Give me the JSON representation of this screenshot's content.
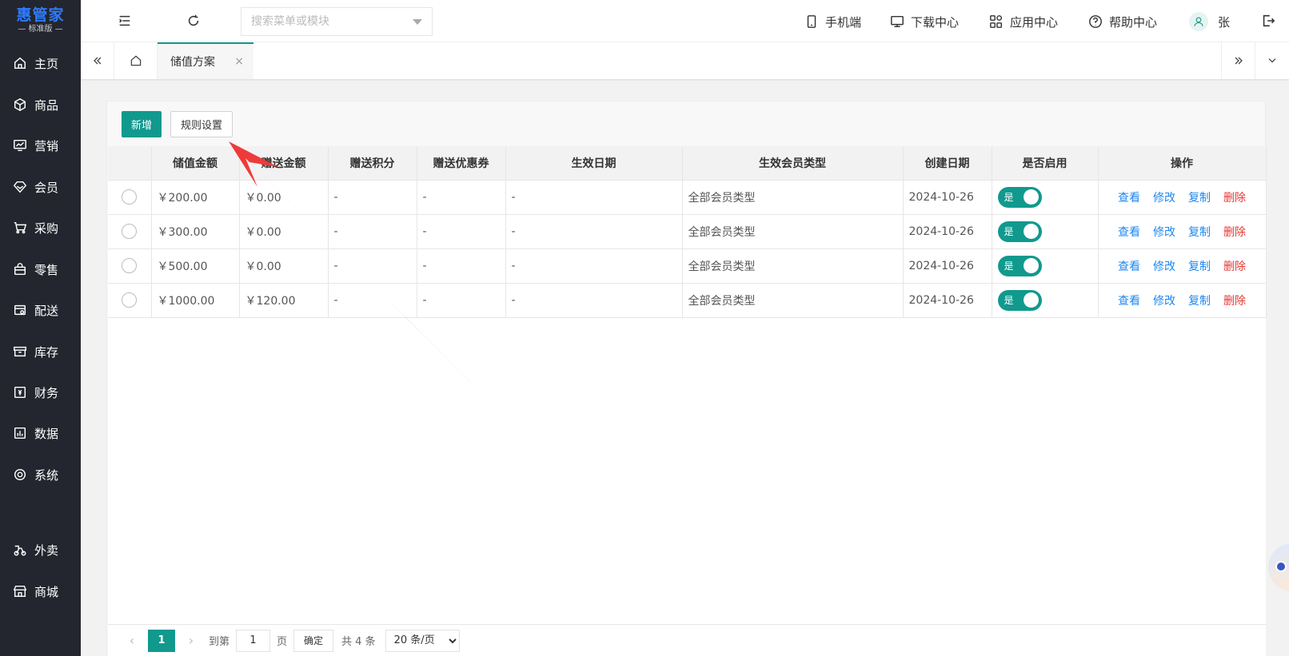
{
  "app": {
    "logo_title": "惠管家",
    "logo_sub": "— 标准版 —"
  },
  "sidebar": {
    "items": [
      {
        "label": "主页",
        "icon": "home-icon"
      },
      {
        "label": "商品",
        "icon": "box-icon"
      },
      {
        "label": "营销",
        "icon": "marketing-icon"
      },
      {
        "label": "会员",
        "icon": "diamond-icon"
      },
      {
        "label": "采购",
        "icon": "cart-icon"
      },
      {
        "label": "零售",
        "icon": "bag-icon"
      },
      {
        "label": "配送",
        "icon": "delivery-icon"
      },
      {
        "label": "库存",
        "icon": "inventory-icon"
      },
      {
        "label": "财务",
        "icon": "finance-icon"
      },
      {
        "label": "数据",
        "icon": "chart-icon"
      },
      {
        "label": "系统",
        "icon": "settings-icon"
      },
      {
        "label": "外卖",
        "icon": "scooter-icon"
      },
      {
        "label": "商城",
        "icon": "shop-icon"
      }
    ]
  },
  "header": {
    "search_placeholder": "搜索菜单或模块",
    "tools": {
      "mobile": "手机端",
      "download": "下载中心",
      "apps": "应用中心",
      "help": "帮助中心",
      "user": "张"
    }
  },
  "tabs": {
    "active": "储值方案",
    "close": "×"
  },
  "toolbar": {
    "add": "新增",
    "rules": "规则设置"
  },
  "table": {
    "headers": [
      "储值金额",
      "赠送金额",
      "赠送积分",
      "赠送优惠券",
      "生效日期",
      "生效会员类型",
      "创建日期",
      "是否启用",
      "操作"
    ],
    "rows": [
      {
        "amount": "￥200.00",
        "gift": "￥0.00",
        "points": "-",
        "coupon": "-",
        "effective": "-",
        "member_type": "全部会员类型",
        "created": "2024-10-26",
        "enabled": "是"
      },
      {
        "amount": "￥300.00",
        "gift": "￥0.00",
        "points": "-",
        "coupon": "-",
        "effective": "-",
        "member_type": "全部会员类型",
        "created": "2024-10-26",
        "enabled": "是"
      },
      {
        "amount": "￥500.00",
        "gift": "￥0.00",
        "points": "-",
        "coupon": "-",
        "effective": "-",
        "member_type": "全部会员类型",
        "created": "2024-10-26",
        "enabled": "是"
      },
      {
        "amount": "￥1000.00",
        "gift": "￥120.00",
        "points": "-",
        "coupon": "-",
        "effective": "-",
        "member_type": "全部会员类型",
        "created": "2024-10-26",
        "enabled": "是"
      }
    ],
    "actions": {
      "view": "查看",
      "edit": "修改",
      "copy": "复制",
      "delete": "删除"
    }
  },
  "pager": {
    "prev": "‹",
    "current": "1",
    "next": "›",
    "goto_label": "到第",
    "goto_value": "1",
    "page_unit": "页",
    "confirm": "确定",
    "total": "共 4 条",
    "page_size": "20 条/页"
  },
  "colors": {
    "primary": "#11998e",
    "sidebar_bg": "#23262e",
    "link": "#1e87f0",
    "danger": "#e53935",
    "annotation": "#f03a3a"
  }
}
